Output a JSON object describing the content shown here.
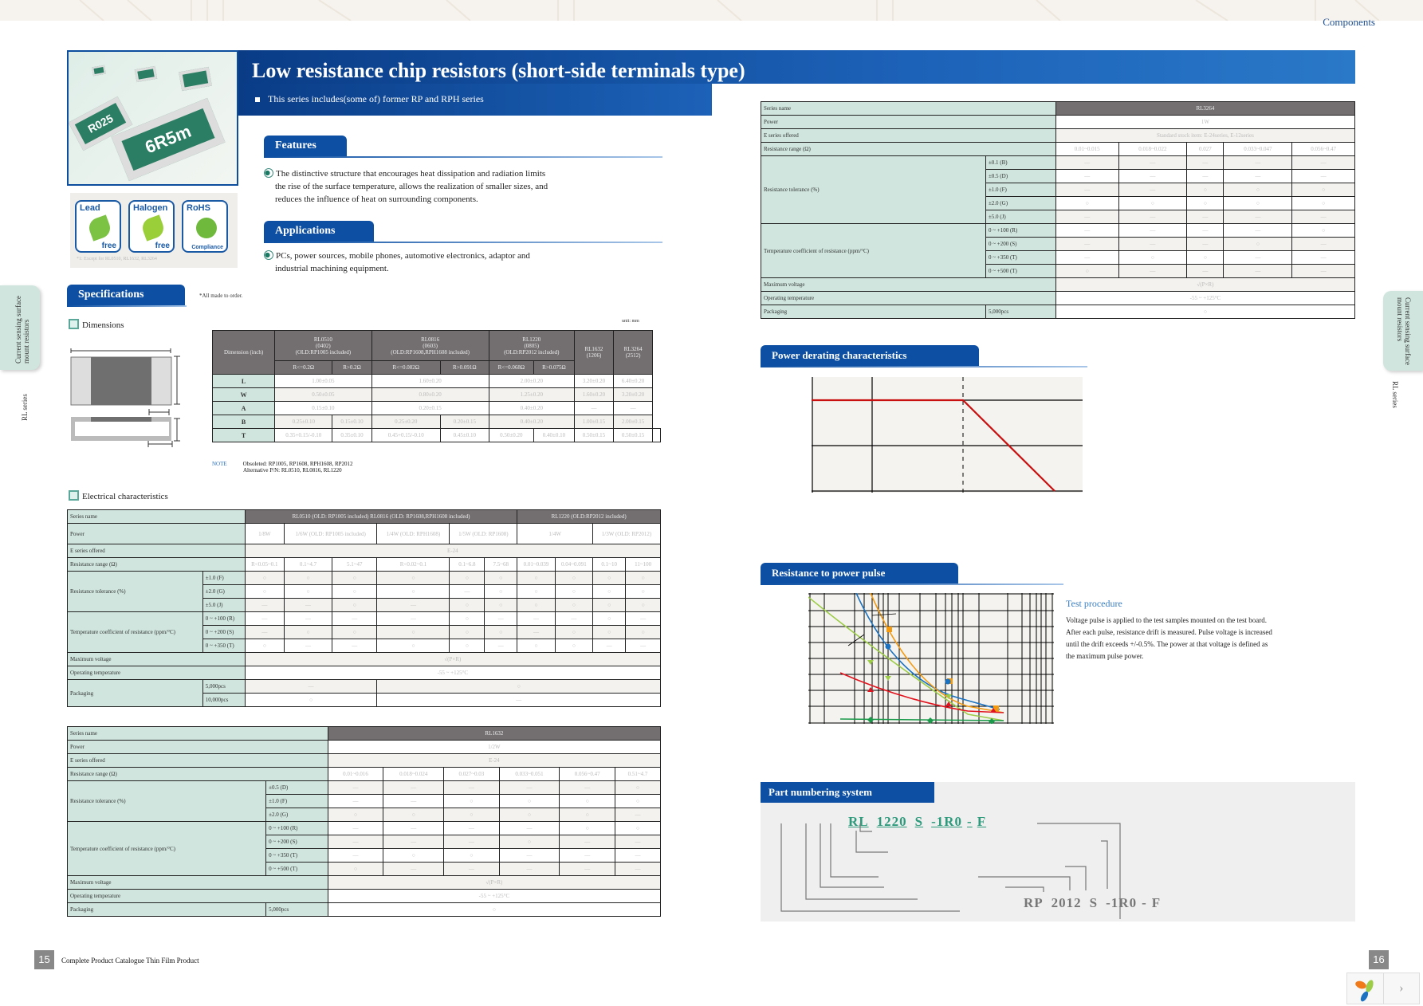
{
  "header": {
    "section_label": "Components",
    "title": "Low resistance chip resistors (short-side terminals type)",
    "subtitle": "This series includes(some of) former RP and RPH series"
  },
  "product_image": {
    "labels": [
      "R025",
      "6R5m"
    ]
  },
  "badges": [
    {
      "top": "Lead",
      "bottom": "free"
    },
    {
      "top": "Halogen",
      "bottom": "free"
    },
    {
      "top": "RoHS",
      "bottom": "Compliance"
    }
  ],
  "badge_note": "*1: Except for RL0510, RL1632, RL3264",
  "features": {
    "title": "Features",
    "items": [
      "The distinctive structure that encourages heat dissipation and radiation limits the rise of the surface temperature, allows the realization of smaller sizes, and reduces the influence of heat on surrounding components."
    ]
  },
  "applications": {
    "title": "Applications",
    "items": [
      "PCs, power sources, mobile phones, automotive electronics, adaptor and industrial machining equipment."
    ]
  },
  "specifications": {
    "title": "Specifications",
    "note": "*All made to order."
  },
  "side_tabs": {
    "left": {
      "category": "Current sensing surface mount resistors",
      "series": "RL series"
    },
    "right": {
      "category": "Current sensing surface mount resistors",
      "series": "RL series"
    }
  },
  "dimensions": {
    "title": "Dimensions",
    "unit": "unit: mm",
    "header": {
      "first": "Dimension\n(inch)",
      "groups": [
        {
          "name": "RL0510",
          "inch": "(0402)",
          "old": "(OLD:RP1005 included)",
          "sub": [
            "R<=0.2Ω",
            "R>0.2Ω"
          ]
        },
        {
          "name": "RL0816",
          "inch": "(0603)",
          "old": "(OLD:RP1608,RPH1608 included)",
          "sub": [
            "R<=0.082Ω",
            "R>0.091Ω"
          ]
        },
        {
          "name": "RL1220",
          "inch": "(0805)",
          "old": "(OLD:RP2012 included)",
          "sub": [
            "R<=0.068Ω",
            "R>0.075Ω"
          ]
        },
        {
          "name": "RL1632",
          "inch": "(1206)"
        },
        {
          "name": "RL3264",
          "inch": "(2512)"
        }
      ]
    },
    "rows": [
      {
        "label": "L",
        "cells": [
          "1.00±0.05",
          "1.60±0.20",
          "2.00±0.20",
          "3.20±0.20",
          "6.40±0.20"
        ]
      },
      {
        "label": "W",
        "cells": [
          "0.50±0.05",
          "0.80±0.20",
          "1.25±0.20",
          "1.60±0.20",
          "3.20±0.20"
        ]
      },
      {
        "label": "A",
        "cells": [
          "0.15±0.10",
          "0.20±0.15",
          "0.40±0.20",
          "—",
          "—"
        ]
      },
      {
        "label": "B",
        "cells": [
          "0.25±0.10",
          "0.15±0.10",
          "0.25±0.20",
          "0.20±0.15",
          "0.40±0.20",
          "1.00±0.15",
          "2.00±0.15"
        ]
      },
      {
        "label": "T",
        "cells": [
          "0.35+0.15/-0.10",
          "0.35±0.10",
          "0.45+0.15/-0.10",
          "0.45±0.10",
          "0.50±0.20",
          "0.40±0.10",
          "0.50±0.15",
          "0.50±0.15",
          "",
          ""
        ]
      }
    ],
    "note_label": "NOTE",
    "notes": [
      "Obsoleted: RP1005, RP1608, RPH1608, RP2012",
      "Alternative P/N: RL0510, RL0816, RL1220"
    ]
  },
  "electrical": {
    "title": "Electrical characteristics",
    "labels": {
      "series": "Series name",
      "power": "Power",
      "eseries": "E series offered",
      "range": "Resistance range (Ω)",
      "tolerance": "Resistance tolerance (%)",
      "tcr": "Temperature coefficient of resistance (ppm/°C)",
      "voltage": "Maximum voltage",
      "optemp": "Operating temperature",
      "packaging": "Packaging"
    },
    "table1": {
      "series": [
        "RL0510 (OLD: RP1005 included)  RL0816 (OLD: RP1608,RPH1608 included)",
        "RL1220 (OLD:RP2012 included)"
      ],
      "power": [
        "1/8W",
        "1/6W (OLD: RP1005 included)",
        "1/4W (OLD: RPH1608)",
        "1/5W (OLD: RP1608)",
        "1/4W",
        "1/3W (OLD: RP2012)"
      ],
      "eseries": "E-24",
      "ranges": [
        "R<0.05~0.1",
        "0.1~4.7",
        "5.1~47",
        "R<0.02~0.1",
        "0.1~6.8",
        "7.5~68",
        "0.01~0.039",
        "0.04~0.091",
        "0.1~10",
        "11~100"
      ],
      "tolerance": [
        {
          "label": "±1.0 (F)",
          "cells": [
            "○",
            "○",
            "○",
            "○",
            "○",
            "○",
            "○",
            "○",
            "○",
            "○"
          ]
        },
        {
          "label": "±2.0 (G)",
          "cells": [
            "○",
            "○",
            "○",
            "○",
            "—",
            "○",
            "○",
            "○",
            "○",
            "○"
          ]
        },
        {
          "label": "±5.0 (J)",
          "cells": [
            "—",
            "—",
            "○",
            "—",
            "○",
            "○",
            "○",
            "○",
            "○",
            "○"
          ]
        }
      ],
      "tcr": [
        {
          "label": "0 ~ +100 (R)",
          "cells": [
            "—",
            "—",
            "—",
            "—",
            "○",
            "—",
            "—",
            "—",
            "○",
            "—"
          ]
        },
        {
          "label": "0 ~ +200 (S)",
          "cells": [
            "—",
            "○",
            "○",
            "○",
            "○",
            "○",
            "—",
            "○",
            "○",
            "○"
          ]
        },
        {
          "label": "0 ~ +350 (T)",
          "cells": [
            "○",
            "—",
            "—",
            "○",
            "○",
            "—",
            "○",
            "○",
            "—",
            "—"
          ]
        }
      ],
      "voltage": "√(P×R)",
      "optemp": "-55 ~ +125°C",
      "packaging": [
        {
          "label": "5,000pcs",
          "cells": [
            "—",
            "○"
          ]
        },
        {
          "label": "10,000pcs",
          "cells": [
            "○",
            "—"
          ]
        }
      ]
    },
    "table2": {
      "series": "RL1632",
      "power": "1/2W",
      "eseries": "E-24",
      "ranges": [
        "0.01~0.016",
        "0.018~0.024",
        "0.027~0.03",
        "0.033~0.051",
        "0.056~0.47",
        "0.51~4.7"
      ],
      "tolerance": [
        {
          "label": "±0.5 (D)",
          "cells": [
            "—",
            "—",
            "—",
            "—",
            "—",
            "○"
          ]
        },
        {
          "label": "±1.0 (F)",
          "cells": [
            "—",
            "—",
            "○",
            "○",
            "○",
            "○"
          ]
        },
        {
          "label": "±2.0 (G)",
          "cells": [
            "○",
            "○",
            "○",
            "○",
            "○",
            "—"
          ]
        }
      ],
      "tcr": [
        {
          "label": "0 ~ +100 (R)",
          "cells": [
            "—",
            "—",
            "—",
            "—",
            "○",
            "○"
          ]
        },
        {
          "label": "0 ~ +200 (S)",
          "cells": [
            "—",
            "—",
            "—",
            "○",
            "—",
            "—"
          ]
        },
        {
          "label": "0 ~ +350 (T)",
          "cells": [
            "—",
            "○",
            "○",
            "—",
            "—",
            "—"
          ]
        },
        {
          "label": "0 ~ +500 (T)",
          "cells": [
            "○",
            "—",
            "—",
            "—",
            "—",
            "—"
          ]
        }
      ],
      "voltage": "√(P×R)",
      "optemp": "-55 ~ +125°C",
      "packaging": {
        "label": "5,000pcs",
        "value": "○"
      }
    },
    "table3": {
      "series": "RL3264",
      "power": "1W",
      "eseries": "Standard stock item: E-24series, E-12series",
      "ranges": [
        "0.01~0.015",
        "0.018~0.022",
        "0.027",
        "0.033~0.047",
        "0.056~0.47"
      ],
      "tolerance": [
        {
          "label": "±0.1 (B)",
          "cells": [
            "—",
            "—",
            "—",
            "—",
            "—"
          ]
        },
        {
          "label": "±0.5 (D)",
          "cells": [
            "—",
            "—",
            "—",
            "—",
            "—"
          ]
        },
        {
          "label": "±1.0 (F)",
          "cells": [
            "—",
            "—",
            "○",
            "○",
            "○"
          ]
        },
        {
          "label": "±2.0 (G)",
          "cells": [
            "○",
            "○",
            "○",
            "○",
            "○"
          ]
        },
        {
          "label": "±5.0 (J)",
          "cells": [
            "—",
            "—",
            "—",
            "—",
            "—"
          ]
        }
      ],
      "tcr": [
        {
          "label": "0 ~ +100 (R)",
          "cells": [
            "—",
            "—",
            "—",
            "—",
            "○"
          ]
        },
        {
          "label": "0 ~ +200 (S)",
          "cells": [
            "—",
            "—",
            "—",
            "○",
            "—"
          ]
        },
        {
          "label": "0 ~ +350 (T)",
          "cells": [
            "—",
            "○",
            "○",
            "—",
            "—"
          ]
        },
        {
          "label": "0 ~ +500 (T)",
          "cells": [
            "○",
            "—",
            "—",
            "—",
            "—"
          ]
        }
      ],
      "voltage": "√(P×R)",
      "optemp": "-55 ~ +125°C",
      "packaging": {
        "label": "5,000pcs",
        "value": "○"
      }
    }
  },
  "power_derating": {
    "title": "Power derating characteristics"
  },
  "pulse": {
    "title": "Resistance to power pulse",
    "test_title": "Test procedure",
    "test_text": [
      "Voltage pulse is applied to the test samples mounted on the test board.",
      "After each pulse, resistance drift is measured. Pulse voltage is increased until the drift exceeds +/-0.5%. The power at that voltage is defined as the maximum pulse power."
    ]
  },
  "part_numbering": {
    "title": "Part numbering system",
    "new": [
      "RL",
      "1220",
      "S",
      "-1R0",
      "-",
      "F"
    ],
    "old": [
      "RP",
      "2012",
      "S",
      "-1R0",
      "-",
      "F"
    ]
  },
  "footer": {
    "left_page": "15",
    "left_text": "Complete Product Catalogue   Thin Film Product",
    "right_page": "16"
  },
  "nav": {
    "next": "›"
  },
  "colors": {
    "brand_blue": "#0d4fa2",
    "label_green": "#cfe5de",
    "header_gray": "#736f71",
    "part_green": "#2e9a7c"
  }
}
